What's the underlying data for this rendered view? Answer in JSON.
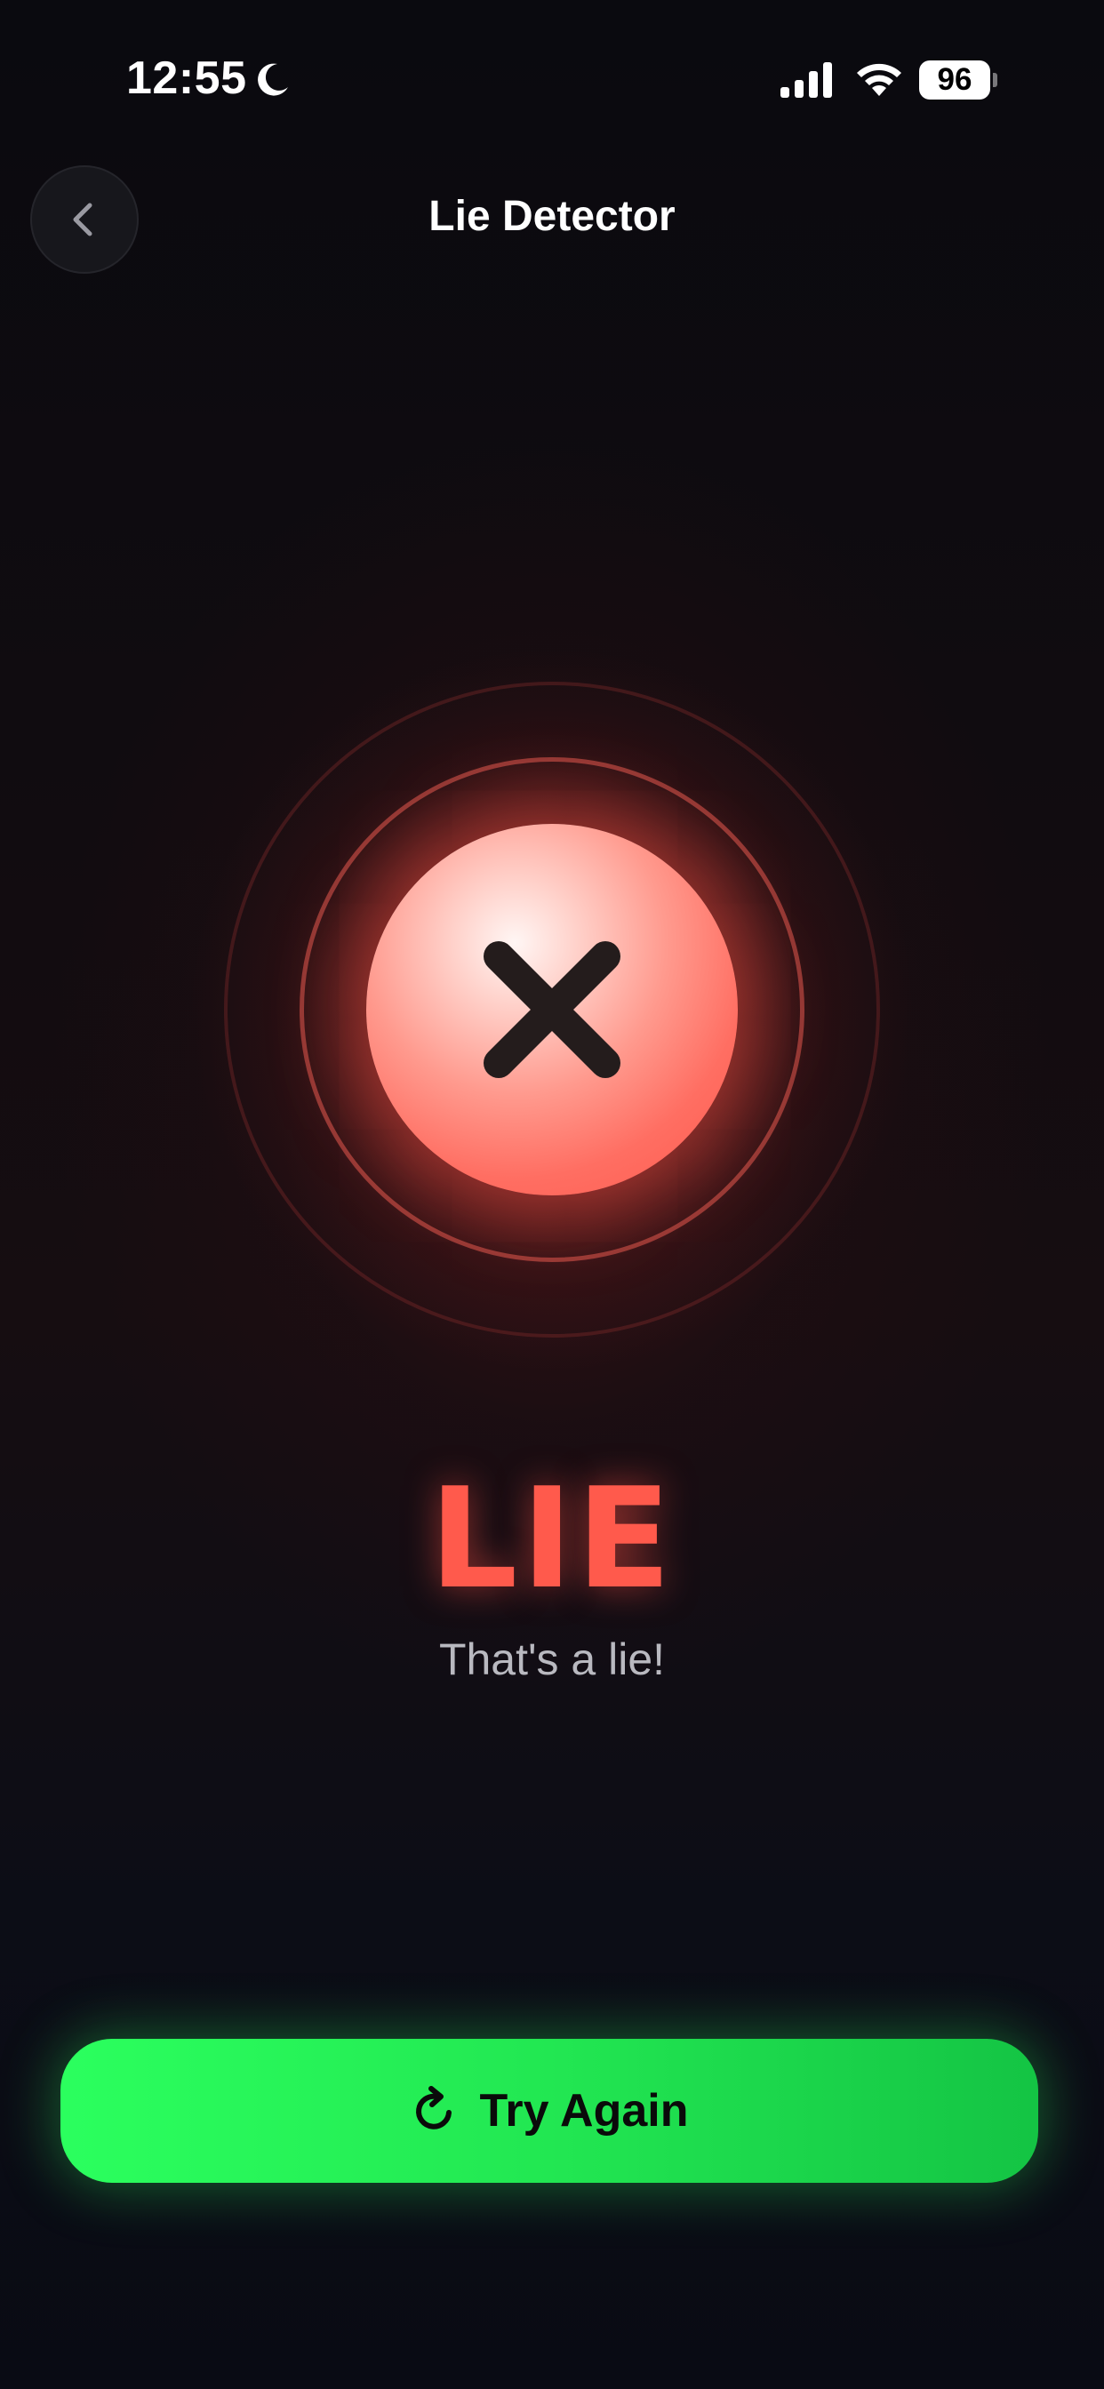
{
  "status_bar": {
    "time": "12:55",
    "battery": "96",
    "icons": [
      "moon-icon",
      "signal-icon",
      "wifi-icon",
      "battery-icon"
    ]
  },
  "header": {
    "title": "Lie Detector",
    "back_icon": "chevron-left-icon"
  },
  "result": {
    "icon": "x-icon",
    "label": "LIE",
    "subtitle": "That's a lie!"
  },
  "actions": {
    "try_again_label": "Try Again",
    "try_again_icon": "refresh-icon"
  },
  "colors": {
    "lie_red": "#ff5a4c",
    "button_green": "#22e752",
    "background": "#0a0a0f"
  }
}
